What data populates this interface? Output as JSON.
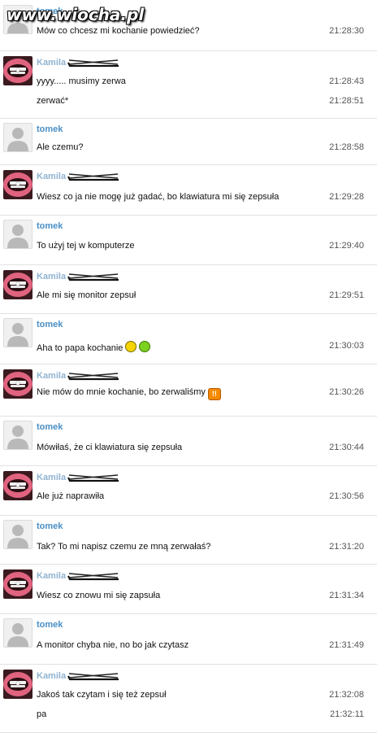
{
  "watermark": "www.wiocha.pl",
  "colors": {
    "name": "#4a8fc6",
    "kamila_name": "#8fb3d1",
    "divider": "#e2e2e2"
  },
  "messages": [
    {
      "sender": "tomek",
      "avatar": "person-silhouette-icon",
      "lines": [
        {
          "text": "Mów co chcesz mi kochanie powiedzieć?",
          "time": "21:28:30"
        }
      ]
    },
    {
      "sender": "Kamila",
      "avatar": "lips-photo",
      "lines": [
        {
          "text": "yyyy..... musimy zerwa",
          "time": "21:28:43"
        },
        {
          "text": "zerwać*",
          "time": "21:28:51"
        }
      ]
    },
    {
      "sender": "tomek",
      "avatar": "person-silhouette-icon",
      "lines": [
        {
          "text": "Ale czemu?",
          "time": "21:28:58"
        }
      ]
    },
    {
      "sender": "Kamila",
      "avatar": "lips-photo",
      "lines": [
        {
          "text": "Wiesz co ja nie mogę już gadać, bo klawiatura mi się zepsuła",
          "time": "21:29:28"
        }
      ]
    },
    {
      "sender": "tomek",
      "avatar": "person-silhouette-icon",
      "lines": [
        {
          "text": "To użyj tej w komputerze",
          "time": "21:29:40"
        }
      ]
    },
    {
      "sender": "Kamila",
      "avatar": "lips-photo",
      "lines": [
        {
          "text": "Ale mi się monitor zepsuł",
          "time": "21:29:51"
        }
      ]
    },
    {
      "sender": "tomek",
      "avatar": "person-silhouette-icon",
      "lines": [
        {
          "text": "Aha to papa kochanie",
          "time": "21:30:03",
          "emoticons": [
            "smile-emoticon-icon",
            "wink-emoticon-icon"
          ]
        }
      ]
    },
    {
      "sender": "Kamila",
      "avatar": "lips-photo",
      "lines": [
        {
          "text": "Nie mów do mnie kochanie, bo zerwaliśmy",
          "time": "21:30:26",
          "emoticons": [
            "exclamation-emoticon-icon"
          ]
        }
      ]
    },
    {
      "sender": "tomek",
      "avatar": "person-silhouette-icon",
      "lines": [
        {
          "text": "Mówiłaś, że ci klawiatura się zepsuła",
          "time": "21:30:44"
        }
      ]
    },
    {
      "sender": "Kamila",
      "avatar": "lips-photo",
      "lines": [
        {
          "text": "Ale już naprawiła",
          "time": "21:30:56"
        }
      ]
    },
    {
      "sender": "tomek",
      "avatar": "person-silhouette-icon",
      "lines": [
        {
          "text": "Tak? To mi napisz czemu ze mną zerwałaś?",
          "time": "21:31:20"
        }
      ]
    },
    {
      "sender": "Kamila",
      "avatar": "lips-photo",
      "lines": [
        {
          "text": "Wiesz co znowu mi się zapsuła",
          "time": "21:31:34"
        }
      ]
    },
    {
      "sender": "tomek",
      "avatar": "person-silhouette-icon",
      "lines": [
        {
          "text": "A monitor chyba nie, no bo jak czytasz",
          "time": "21:31:49"
        }
      ]
    },
    {
      "sender": "Kamila",
      "avatar": "lips-photo",
      "lines": [
        {
          "text": "Jakoś tak czytam i się też zepsuł",
          "time": "21:32:08"
        },
        {
          "text": "pa",
          "time": "21:32:11"
        }
      ]
    }
  ]
}
